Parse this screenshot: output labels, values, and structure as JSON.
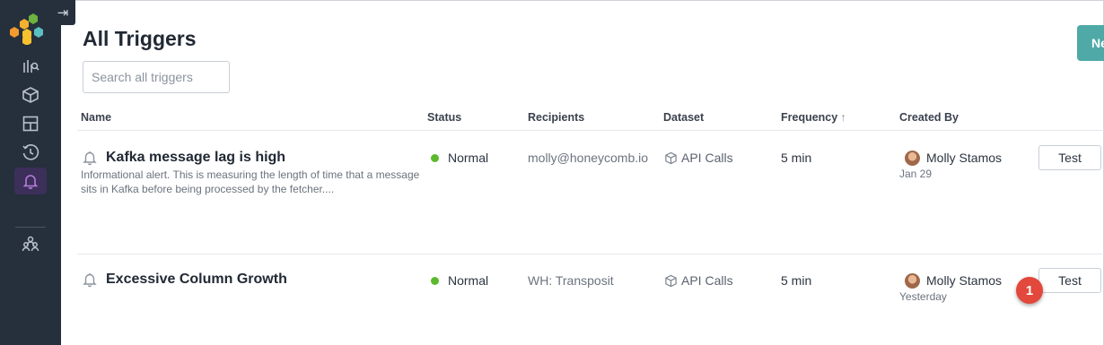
{
  "sidebar": {
    "collapse_icon": "collapse-right-icon",
    "nav": [
      {
        "icon": "query-icon",
        "active": false
      },
      {
        "icon": "dataset-icon",
        "active": false
      },
      {
        "icon": "board-icon",
        "active": false
      },
      {
        "icon": "history-icon",
        "active": false
      },
      {
        "icon": "bell-icon",
        "active": true
      },
      {
        "icon": "team-icon",
        "active": false
      }
    ]
  },
  "header": {
    "title": "All Triggers",
    "new_button_label": "Ne",
    "search_placeholder": "Search all triggers"
  },
  "table": {
    "columns": {
      "name": "Name",
      "status": "Status",
      "recipients": "Recipients",
      "dataset": "Dataset",
      "frequency": "Frequency",
      "frequency_sort": "↑",
      "created_by": "Created By"
    },
    "rows": [
      {
        "name": "Kafka message lag is high",
        "description": "Informational alert. This is measuring the length of time that a message sits in Kafka before being processed by the fetcher....",
        "status": "Normal",
        "recipients": "molly@honeycomb.io",
        "dataset": "API Calls",
        "frequency": "5 min",
        "creator": "Molly Stamos",
        "created_date": "Jan 29",
        "test_label": "Test"
      },
      {
        "name": "Excessive Column Growth",
        "description": "",
        "status": "Normal",
        "recipients": "WH: Transposit",
        "dataset": "API Calls",
        "frequency": "5 min",
        "creator": "Molly Stamos",
        "created_date": "Yesterday",
        "test_label": "Test"
      }
    ]
  },
  "callout": {
    "number": "1"
  },
  "colors": {
    "sidebar_bg": "#262f3c",
    "accent_teal": "#4fa9a7",
    "status_green": "#5cb82e",
    "callout_red": "#e2483b"
  }
}
